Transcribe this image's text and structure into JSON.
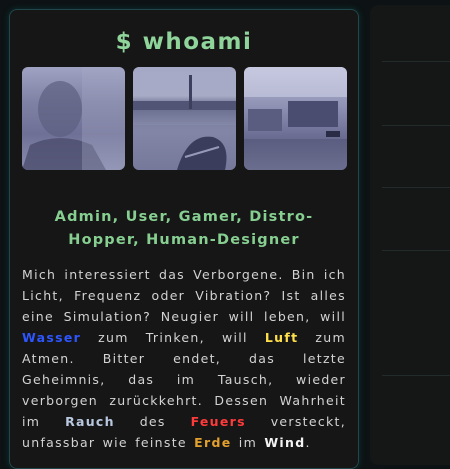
{
  "profile": {
    "title": "$ whoami",
    "photos": [
      {
        "icon": "portrait-photo"
      },
      {
        "icon": "outdoor-photo"
      },
      {
        "icon": "desk-setup-photo"
      }
    ],
    "roles": "Admin, User, Gamer, Distro-Hopper, Human-Designer",
    "bio": {
      "p1": "Mich interessiert das Verborgene. Bin ich Licht, Frequenz oder Vibration? Ist alles eine Simulation? Neugier will leben, will",
      "wasser": "Wasser",
      "p2": "zum Trinken, will",
      "luft": "Luft",
      "p3": "zum Atmen. Bitter endet, das letzte Geheimnis, das im Tausch, wieder verborgen zurückkehrt. Dessen Wahrheit im",
      "rauch": "Rauch",
      "p4": "des",
      "feuers": "Feuers",
      "p5": "versteckt, unfassbar wie feinste",
      "erde": "Erde",
      "p6": "im",
      "wind": "Wind",
      "p7": "."
    }
  },
  "colors": {
    "accent_green": "#8fd49a",
    "wasser": "#2d56ff",
    "luft": "#ffe04a",
    "rauch": "#b9c8e0",
    "feuers": "#ff3a3a",
    "erde": "#e2a02e",
    "wind": "#f4f4f4"
  }
}
